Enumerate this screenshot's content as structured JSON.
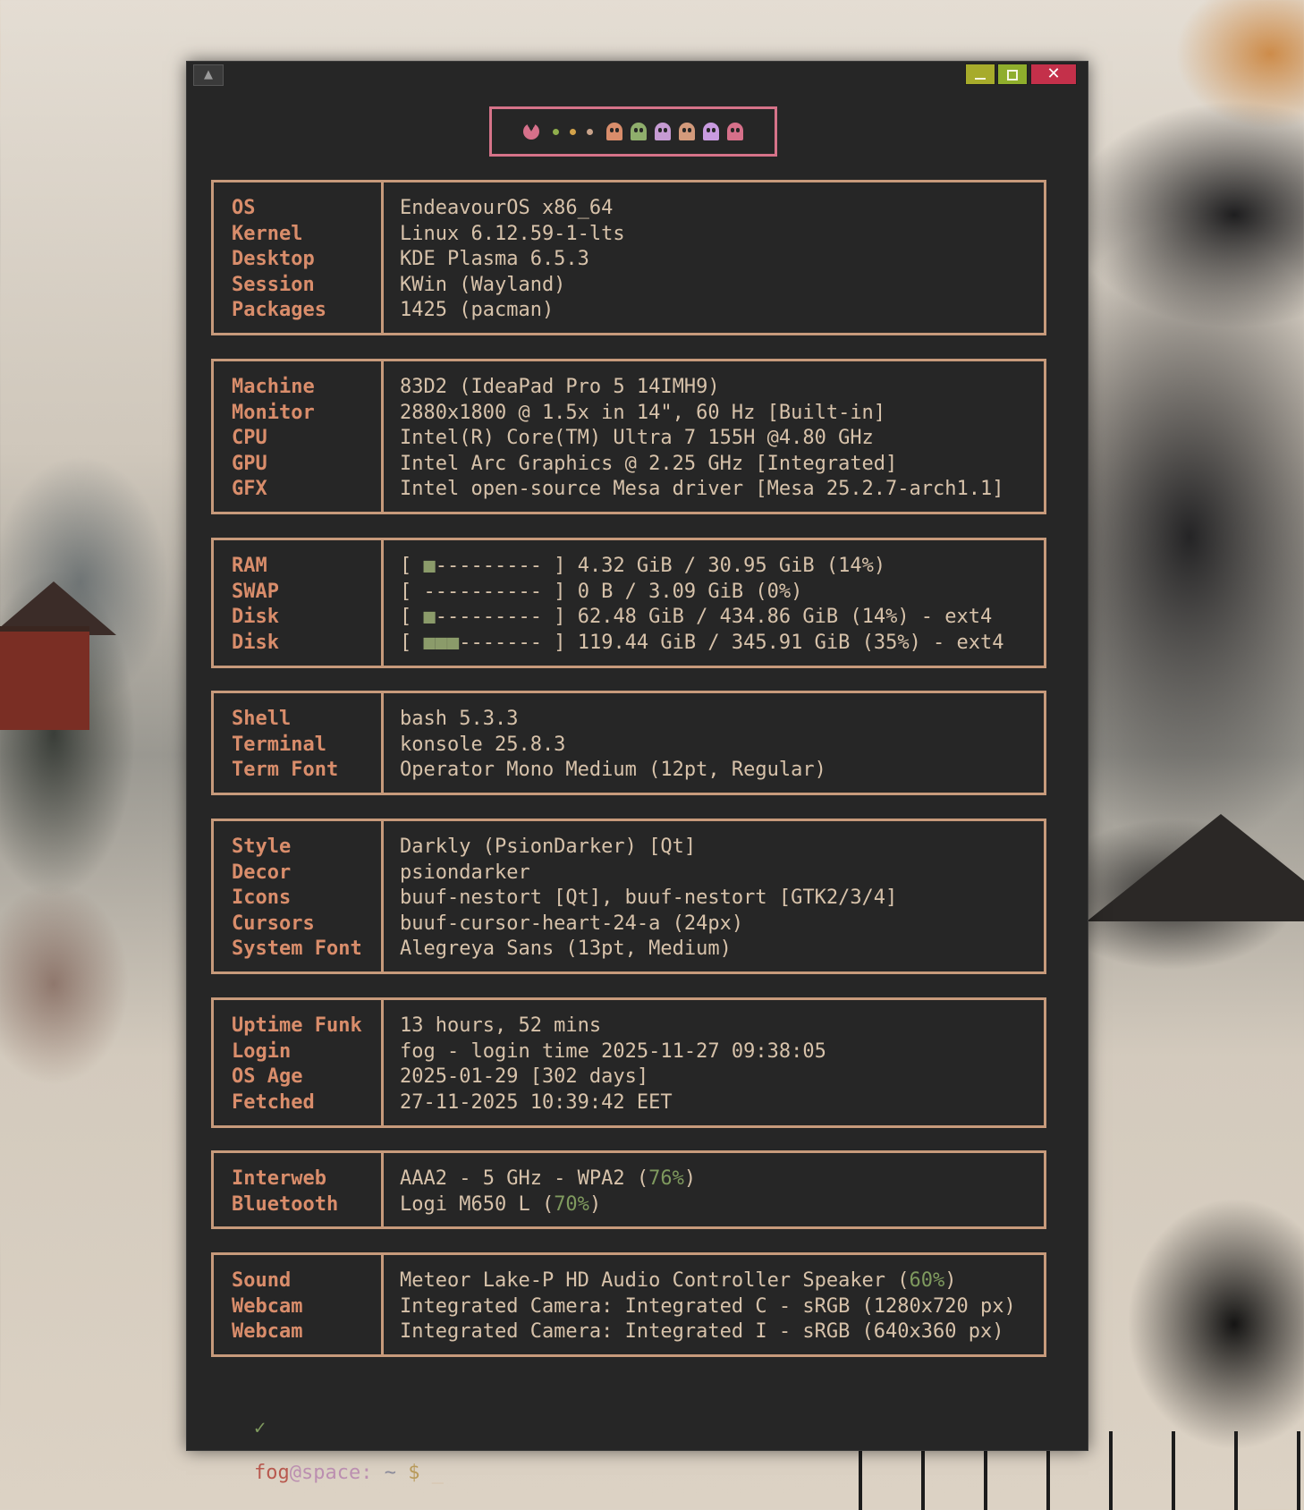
{
  "colors": {
    "window_bg": "#262626",
    "box_border": "#c79a7b",
    "label": "#d98d6b",
    "value": "#d7c2aa",
    "accent_pink": "#d67389",
    "percent_green": "#7f9a5e"
  },
  "titlebar": {
    "menu_icon": "up-arrow-icon",
    "minimize_icon": "minimize-icon",
    "maximize_icon": "maximize-icon",
    "close_icon": "close-icon",
    "close_glyph": "✕"
  },
  "pacman": {
    "pellet_colors": [
      "#8fae4c",
      "#d3a24a",
      "#c9a38a"
    ],
    "ghost_colors": [
      "#d98d6b",
      "#8fae6c",
      "#c69bd3",
      "#d39a7b",
      "#c99be0",
      "#d6708a"
    ]
  },
  "boxes": [
    {
      "labels": [
        "OS",
        "Kernel",
        "Desktop",
        "Session",
        "Packages"
      ],
      "values": [
        "EndeavourOS x86_64",
        "Linux 6.12.59-1-lts",
        "KDE Plasma 6.5.3",
        "KWin (Wayland)",
        "1425 (pacman)"
      ]
    },
    {
      "labels": [
        "Machine",
        "Monitor",
        "CPU",
        "GPU",
        "GFX"
      ],
      "values": [
        "83D2 (IdeaPad Pro 5 14IMH9)",
        "2880x1800 @ 1.5x in 14\", 60 Hz [Built-in]",
        "Intel(R) Core(TM) Ultra 7 155H @4.80 GHz",
        "Intel Arc Graphics @ 2.25 GHz [Integrated]",
        "Intel open-source Mesa driver [Mesa 25.2.7-arch1.1]"
      ]
    },
    {
      "labels": [
        "RAM",
        "SWAP",
        "Disk",
        "Disk"
      ],
      "bars": [
        {
          "open": "[ ",
          "fill": "■",
          "rest": "--------- ] ",
          "text": "4.32 GiB / 30.95 GiB (14%)"
        },
        {
          "open": "[ ",
          "fill": "",
          "rest": "---------- ] ",
          "text": "0 B / 3.09 GiB (0%)"
        },
        {
          "open": "[ ",
          "fill": "■",
          "rest": "--------- ] ",
          "text": "62.48 GiB / 434.86 GiB (14%) - ext4"
        },
        {
          "open": "[ ",
          "fill": "■■■",
          "rest": "------- ] ",
          "text": "119.44 GiB / 345.91 GiB (35%) - ext4"
        }
      ]
    },
    {
      "labels": [
        "Shell",
        "Terminal",
        "Term Font"
      ],
      "values": [
        "bash 5.3.3",
        "konsole 25.8.3",
        "Operator Mono Medium (12pt, Regular)"
      ]
    },
    {
      "labels": [
        "Style",
        "Decor",
        "Icons",
        "Cursors",
        "System Font"
      ],
      "values": [
        "Darkly (PsionDarker) [Qt]",
        "psiondarker",
        "buuf-nestort [Qt], buuf-nestort [GTK2/3/4]",
        "buuf-cursor-heart-24-a (24px)",
        "Alegreya Sans (13pt, Medium)"
      ]
    },
    {
      "labels": [
        "Uptime Funk",
        "Login",
        "OS Age",
        "Fetched"
      ],
      "values": [
        "13 hours, 52 mins",
        "fog - login time 2025-11-27 09:38:05",
        "2025-01-29 [302 days]",
        "27-11-2025 10:39:42 EET"
      ]
    },
    {
      "labels": [
        "Interweb",
        "Bluetooth"
      ],
      "pct_rows": [
        {
          "pre": "AAA2 - 5 GHz - WPA2 (",
          "pct": "76%",
          "post": ")"
        },
        {
          "pre": "Logi M650 L (",
          "pct": "70%",
          "post": ")"
        }
      ]
    },
    {
      "labels": [
        "Sound",
        "Webcam",
        "Webcam"
      ],
      "pct_rows": [
        {
          "pre": "Meteor Lake-P HD Audio Controller Speaker (",
          "pct": "60%",
          "post": ")"
        },
        {
          "pre": "Integrated Camera: Integrated C - sRGB (1280x720 px)",
          "pct": "",
          "post": ""
        },
        {
          "pre": "Integrated Camera: Integrated I - sRGB (640x360 px)",
          "pct": "",
          "post": ""
        }
      ]
    }
  ],
  "prompt": {
    "check": "✓",
    "user": "fog",
    "at": "@",
    "host": "space:",
    "dir": " ~ ",
    "sign": "$",
    "cursor": " _"
  }
}
